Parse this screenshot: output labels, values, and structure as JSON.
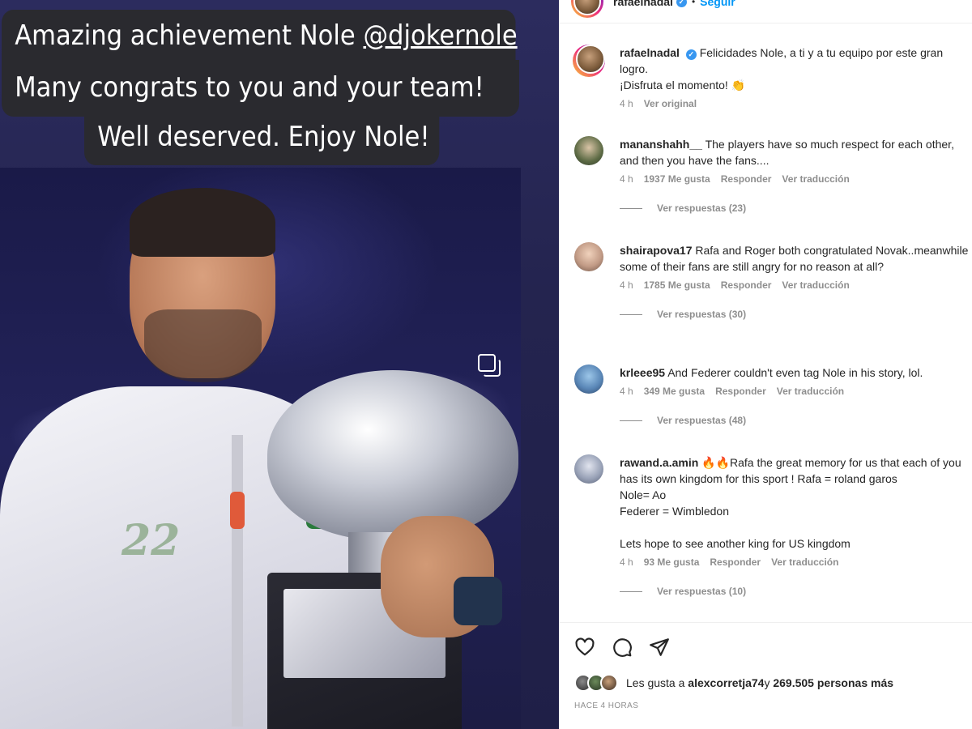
{
  "story": {
    "line1_text": "Amazing achievement Nole ",
    "line1_tag": "@djokernole",
    "line2": "Many congrats to you and your team!",
    "line3": "Well deserved. Enjoy Nole!",
    "jacket_number": "22"
  },
  "header": {
    "username": "rafaelnadal",
    "separator": "•",
    "follow_label": "Seguir"
  },
  "caption": {
    "username": "rafaelnadal",
    "text_line1": "Felicidades Nole, a ti y a tu equipo por este gran logro.",
    "text_line2": "¡Disfruta el momento! 👏",
    "time": "4 h",
    "see_original": "Ver original"
  },
  "comments": [
    {
      "username": "mananshahh__",
      "text": "The players have so much respect for each other, and then you have the fans....",
      "time": "4 h",
      "likes": "1937 Me gusta",
      "reply": "Responder",
      "translate": "Ver traducción",
      "replies": "Ver respuestas (23)"
    },
    {
      "username": "shairapova17",
      "text": "Rafa and Roger both congratulated Novak..meanwhile some of their fans are still angry for no reason at all?",
      "time": "4 h",
      "likes": "1785 Me gusta",
      "reply": "Responder",
      "translate": "Ver traducción",
      "replies": "Ver respuestas (30)"
    },
    {
      "username": "krleee95",
      "text": "And Federer couldn't even tag Nole in his story, lol.",
      "time": "4 h",
      "likes": "349 Me gusta",
      "reply": "Responder",
      "translate": "Ver traducción",
      "replies": "Ver respuestas (48)"
    },
    {
      "username": "rawand.a.amin",
      "text": "🔥🔥Rafa the great memory for us that each of you has its own kingdom for this sport ! Rafa = roland garos",
      "text_line2": "Nole= Ao",
      "text_line3": "Federer = Wimbledon",
      "text_line4": "Lets hope to see another king for US kingdom",
      "time": "4 h",
      "likes": "93 Me gusta",
      "reply": "Responder",
      "translate": "Ver traducción",
      "replies": "Ver respuestas (10)"
    }
  ],
  "footer": {
    "likes_prefix": "Les gusta a ",
    "likes_user": "alexcorretja74",
    "likes_mid": " y ",
    "likes_count": "269.505 personas más",
    "timestamp": "HACE 4 HORAS"
  },
  "icons": {
    "like": "heart-icon",
    "comment": "comment-icon",
    "share": "paper-plane-icon",
    "verified": "verified-badge-icon",
    "multi": "carousel-icon"
  },
  "colors": {
    "accent": "#0095f6",
    "verified": "#3897f0",
    "muted": "#8e8e8e",
    "text": "#262626"
  }
}
